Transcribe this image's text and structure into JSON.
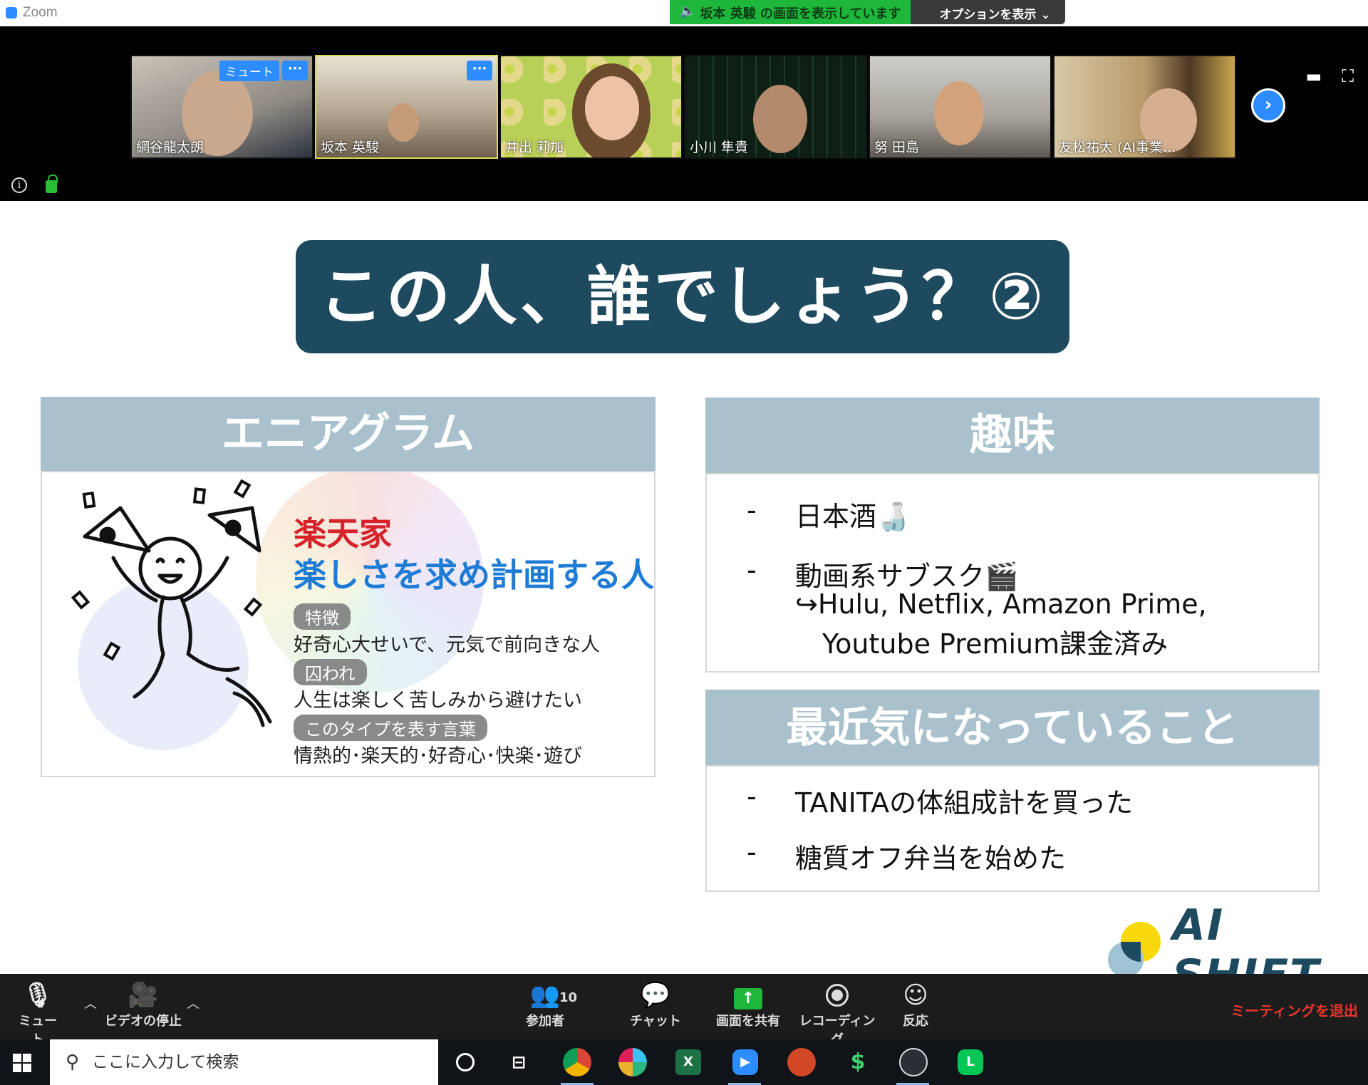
{
  "window": {
    "app_title": "Zoom"
  },
  "share_banner": {
    "sharing_text": "坂本 英駿 の画面を表示しています",
    "options_label": "オプションを表示 ⌄"
  },
  "participants": [
    {
      "name": "網谷龍太朗",
      "badge": "ミュート"
    },
    {
      "name": "坂本 英駿"
    },
    {
      "name": "井出 莉加"
    },
    {
      "name": "小川 隼貴"
    },
    {
      "name": "努 田島"
    },
    {
      "name": "友松祐太 (AI事業..."
    }
  ],
  "slide": {
    "title": "この人、誰でしょう？②",
    "enneagram": {
      "header": "エニアグラム",
      "type_name": "楽天家",
      "type_desc": "楽しさを求め計画する人",
      "feature_label": "特徴",
      "feature_text": "好奇心大せいで、元気で前向きな人",
      "bound_label": "囚われ",
      "bound_text": "人生は楽しく苦しみから避けたい",
      "words_label": "このタイプを表す言葉",
      "words_text": "情熱的･楽天的･好奇心･快楽･遊び"
    },
    "hobbies": {
      "header": "趣味",
      "dash": "-",
      "item1": "日本酒🍶",
      "item2": "動画系サブスク🎬",
      "item2_sub1": "↪Hulu, Netflix, Amazon Prime,",
      "item2_sub2": "Youtube Premium課金済み"
    },
    "recent": {
      "header": "最近気になっていること",
      "dash": "-",
      "item1": "TANITAの体組成計を買った",
      "item2": "糖質オフ弁当を始めた"
    },
    "logo_text": "AI SHIFT"
  },
  "toolbar": {
    "mute": "ミュート",
    "video": "ビデオの停止",
    "participants": "参加者",
    "participant_count": "10",
    "chat": "チャット",
    "share": "画面を共有",
    "record": "レコーディング",
    "reactions": "反応",
    "leave": "ミーティングを退出"
  },
  "taskbar": {
    "search_placeholder": "ここに入力して検索"
  },
  "colors": {
    "zoom_blue": "#2d8cff",
    "slide_navy": "#1d4a5e",
    "panel_header": "#a9c1cd",
    "share_green": "#1fb73b",
    "leave_red": "#e8372c"
  }
}
